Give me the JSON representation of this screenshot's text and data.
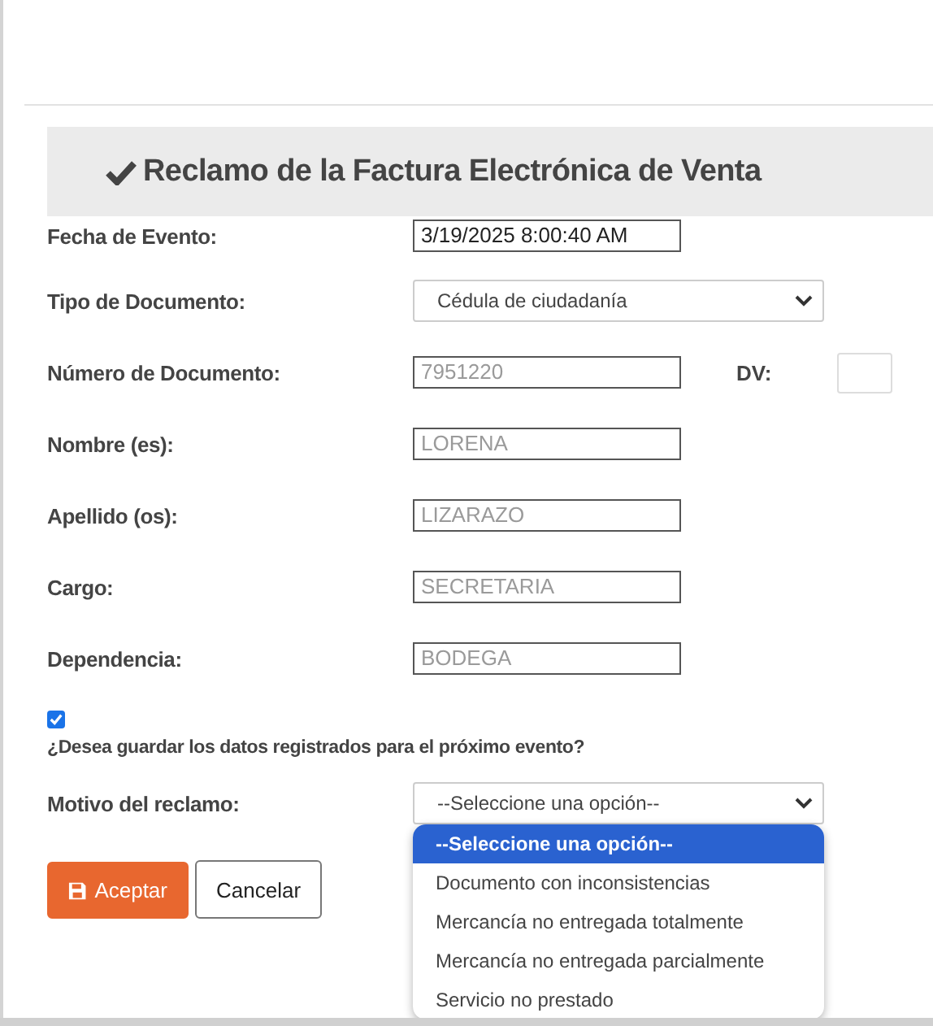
{
  "header": {
    "title": "Reclamo de la Factura Electrónica de Venta"
  },
  "fields": [
    {
      "kind": "text",
      "label": "Fecha de Evento:",
      "value": "3/19/2025 8:00:40 AM",
      "disabled": false
    },
    {
      "kind": "select",
      "label": "Tipo de Documento:",
      "value": "Cédula de ciudadanía"
    },
    {
      "kind": "text",
      "label": "Número de Documento:",
      "value": "7951220",
      "disabled": true,
      "dv_label": "DV:"
    },
    {
      "kind": "text",
      "label": "Nombre (es):",
      "value": "LORENA",
      "disabled": true
    },
    {
      "kind": "text",
      "label": "Apellido (os):",
      "value": "LIZARAZO",
      "disabled": true
    },
    {
      "kind": "text",
      "label": "Cargo:",
      "value": "SECRETARIA",
      "disabled": true
    },
    {
      "kind": "text",
      "label": "Dependencia:",
      "value": "BODEGA",
      "disabled": true
    }
  ],
  "save_option": {
    "checked": true,
    "label": "¿Desea guardar los datos registrados para el próximo evento?"
  },
  "motivo": {
    "label": "Motivo del reclamo:",
    "value": "--Seleccione una opción--",
    "expanded": true,
    "options": [
      {
        "label": "--Seleccione una opción--",
        "selected": true
      },
      {
        "label": "Documento con inconsistencias",
        "selected": false
      },
      {
        "label": "Mercancía no entregada totalmente",
        "selected": false
      },
      {
        "label": "Mercancía no entregada parcialmente",
        "selected": false
      },
      {
        "label": "Servicio no prestado",
        "selected": false
      }
    ]
  },
  "buttons": [
    {
      "kind": "primary",
      "label": "Aceptar"
    },
    {
      "kind": "secondary",
      "label": "Cancelar"
    }
  ]
}
